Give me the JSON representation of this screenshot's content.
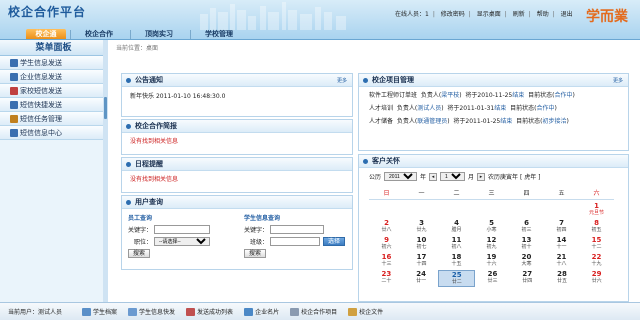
{
  "header": {
    "title": "校企合作平台",
    "brand": "学而業",
    "links": [
      "在线人员：1",
      "修改密码",
      "显示桌面",
      "刷新",
      "帮助",
      "退出"
    ]
  },
  "nav": {
    "tabs": [
      {
        "label": "校企通",
        "active": true
      },
      {
        "label": "校企合作",
        "active": false
      },
      {
        "label": "顶岗实习",
        "active": false
      },
      {
        "label": "学校管理",
        "active": false
      }
    ]
  },
  "sidebar": {
    "title": "菜单面板",
    "items": [
      {
        "label": "学生信息发送",
        "icon": "person-icon",
        "color": "#3a6fb0"
      },
      {
        "label": "企业信息发送",
        "icon": "person-icon",
        "color": "#3a6fb0"
      },
      {
        "label": "家校短信发送",
        "icon": "notebook-icon",
        "color": "#c04040"
      },
      {
        "label": "短信快捷发送",
        "icon": "mail-icon",
        "color": "#3a6fb0"
      },
      {
        "label": "短信任务管理",
        "icon": "task-icon",
        "color": "#c08020"
      },
      {
        "label": "短信信息中心",
        "icon": "computer-icon",
        "color": "#3a6fb0"
      }
    ]
  },
  "breadcrumb": "当前位置：桌面",
  "notice": {
    "title": "公告通知",
    "more": "更多",
    "item": {
      "text": "新年快乐",
      "date": "2011-01-10 16:48:30.0"
    }
  },
  "briefing": {
    "title": "校企合作简报",
    "empty": "没有找到相关信息"
  },
  "reminder": {
    "title": "日程提醒",
    "empty": "没有找到相关信息"
  },
  "user_query": {
    "title": "用户查询",
    "staff": {
      "title": "员工查询",
      "keyword_label": "关键字：",
      "position_label": "职位：",
      "position_value": "--请选择--",
      "search_label": "搜索"
    },
    "student": {
      "title": "学生信息查询",
      "keyword_label": "关键字：",
      "class_label": "班级：",
      "select_label": "选择",
      "search_label": "搜索"
    }
  },
  "projects": {
    "title": "校企项目管理",
    "more": "更多",
    "items": [
      {
        "name": "软件工程师订单班",
        "owner_label": "负责人",
        "owner": "梁平枝",
        "end_label": "将于2010-11-25",
        "end_status": "结束",
        "status_label": "目前状态",
        "status": "合作中"
      },
      {
        "name": "人才培训",
        "owner_label": "负责人",
        "owner": "测试人员",
        "end_label": "将于2011-01-31",
        "end_status": "结束",
        "status_label": "目前状态",
        "status": "合作中"
      },
      {
        "name": "人才储备",
        "owner_label": "负责人",
        "owner": "联通管理员",
        "end_label": "将于2011-01-25",
        "end_status": "结束",
        "status_label": "目前状态",
        "status": "初步接洽"
      }
    ]
  },
  "calendar": {
    "title": "客户关怀",
    "calendar_label": "公历",
    "year": "2011",
    "year_unit": "年",
    "month": "1",
    "month_unit": "月",
    "lunar": "农历庚寅年 [ 虎年 ]",
    "weekdays": [
      "日",
      "一",
      "二",
      "三",
      "四",
      "五",
      "六"
    ],
    "weeks": [
      [
        {
          "d": "",
          "l": ""
        },
        {
          "d": "",
          "l": ""
        },
        {
          "d": "",
          "l": ""
        },
        {
          "d": "",
          "l": ""
        },
        {
          "d": "",
          "l": ""
        },
        {
          "d": "",
          "l": ""
        },
        {
          "d": "1",
          "l": "元旦节",
          "hol": true
        }
      ],
      [
        {
          "d": "2",
          "l": "廿八"
        },
        {
          "d": "3",
          "l": "廿九"
        },
        {
          "d": "4",
          "l": "腊月"
        },
        {
          "d": "5",
          "l": "小寒"
        },
        {
          "d": "6",
          "l": "初三"
        },
        {
          "d": "7",
          "l": "初四"
        },
        {
          "d": "8",
          "l": "初五"
        }
      ],
      [
        {
          "d": "9",
          "l": "初六"
        },
        {
          "d": "10",
          "l": "初七"
        },
        {
          "d": "11",
          "l": "初八"
        },
        {
          "d": "12",
          "l": "初九"
        },
        {
          "d": "13",
          "l": "初十"
        },
        {
          "d": "14",
          "l": "十一"
        },
        {
          "d": "15",
          "l": "十二"
        }
      ],
      [
        {
          "d": "16",
          "l": "十三"
        },
        {
          "d": "17",
          "l": "十四"
        },
        {
          "d": "18",
          "l": "十五"
        },
        {
          "d": "19",
          "l": "十六"
        },
        {
          "d": "20",
          "l": "大寒"
        },
        {
          "d": "21",
          "l": "十八"
        },
        {
          "d": "22",
          "l": "十九"
        }
      ],
      [
        {
          "d": "23",
          "l": "二十"
        },
        {
          "d": "24",
          "l": "廿一"
        },
        {
          "d": "25",
          "l": "廿二",
          "today": true
        },
        {
          "d": "26",
          "l": "廿三"
        },
        {
          "d": "27",
          "l": "廿四"
        },
        {
          "d": "28",
          "l": "廿五"
        },
        {
          "d": "29",
          "l": "廿六"
        }
      ]
    ]
  },
  "footer": {
    "user": "当前用户：测试人员",
    "items": [
      {
        "label": "学生档案",
        "color": "#5a8fc8"
      },
      {
        "label": "学生信息快发",
        "color": "#6b9ad0"
      },
      {
        "label": "发送成功列表",
        "color": "#c05050"
      },
      {
        "label": "企业名片",
        "color": "#4b88c6"
      },
      {
        "label": "校企合作项目",
        "color": "#8a9ab0"
      },
      {
        "label": "校企文件",
        "color": "#d0a040"
      }
    ]
  }
}
